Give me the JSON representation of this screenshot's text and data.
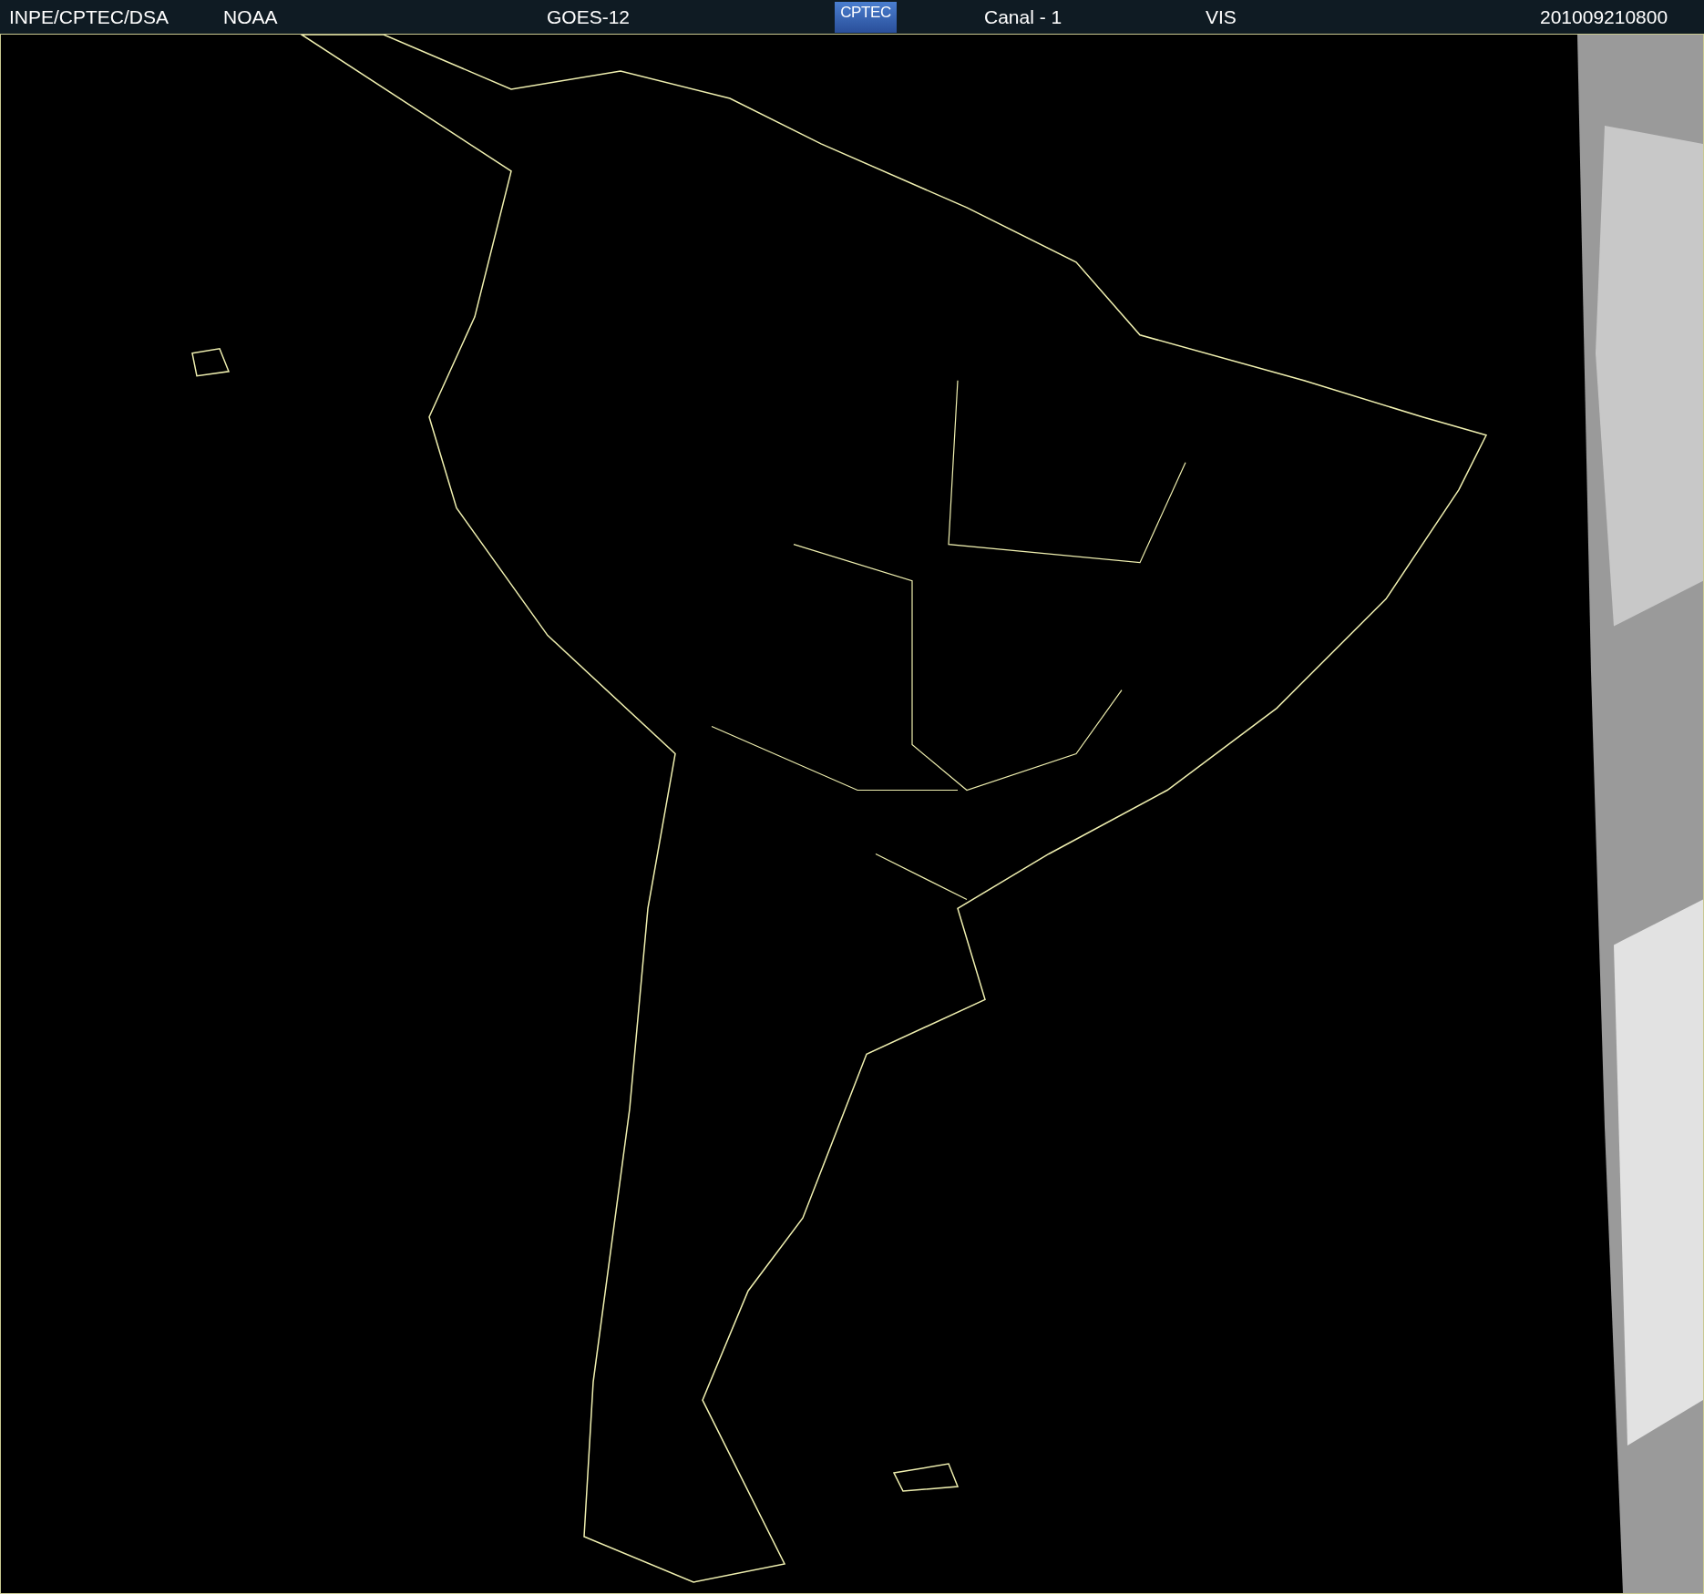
{
  "header": {
    "source": "INPE/CPTEC/DSA",
    "agency": "NOAA",
    "satellite": "GOES-12",
    "logo_text": "CPTEC",
    "channel": "Canal - 1",
    "band": "VIS",
    "timestamp": "201009210800"
  }
}
